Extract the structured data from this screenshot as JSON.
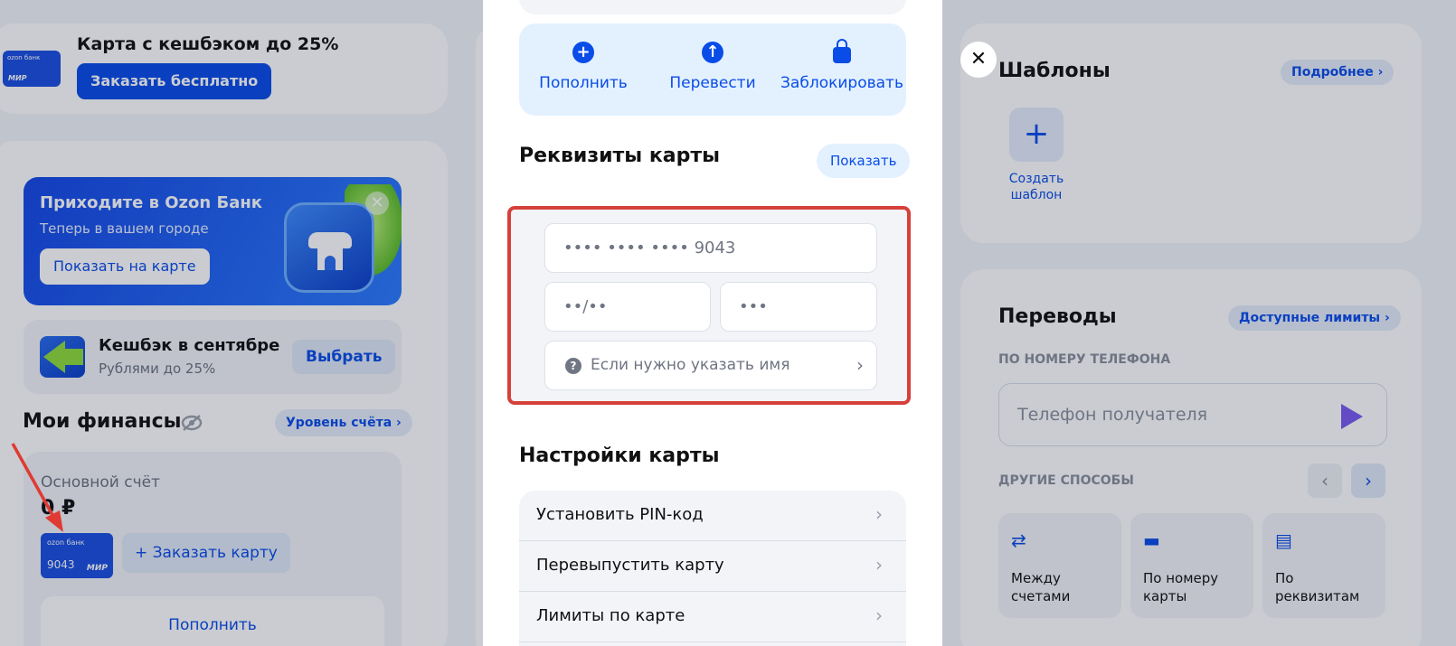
{
  "promo": {
    "card_brand": "ozon банк",
    "card_mir": "МИР",
    "title": "Карта с кешбэком до 25%",
    "button": "Заказать бесплатно"
  },
  "banner": {
    "title": "Приходите в Ozon Банк",
    "subtitle": "Теперь в вашем городе",
    "button": "Показать на карте",
    "close": "✕"
  },
  "cashback": {
    "title": "Кешбэк в сентябре",
    "subtitle": "Рублями до 25%",
    "button": "Выбрать"
  },
  "finances": {
    "title": "Мои финансы",
    "level_button": "Уровень счёта ›",
    "account_label": "Основной счёт",
    "account_value": "0 ₽",
    "card_brand": "ozon банк",
    "card_number": "9043",
    "card_mir": "МИР",
    "order_card_button": "+ Заказать карту",
    "topup_button": "Пополнить"
  },
  "templates": {
    "title": "Шаблоны",
    "more_button": "Подробнее ›",
    "plus": "+",
    "create_label": "Создать шаблон"
  },
  "transfers": {
    "title": "Переводы",
    "limits_button": "Доступные лимиты ›",
    "by_phone_label": "ПО НОМЕРУ ТЕЛЕФОНА",
    "phone_placeholder": "Телефон получателя",
    "other_label": "ДРУГИЕ СПОСОБЫ",
    "prev": "‹",
    "next": "›",
    "methods": [
      {
        "label": "Между счетами",
        "icon": "⇄"
      },
      {
        "label": "По номеру карты",
        "icon": "▬"
      },
      {
        "label": "По реквизитам",
        "icon": "▤"
      }
    ]
  },
  "modal": {
    "close": "✕",
    "actions": [
      {
        "label": "Пополнить",
        "icon": "+"
      },
      {
        "label": "Перевести",
        "icon": "↑"
      },
      {
        "label": "Заблокировать",
        "icon": ""
      }
    ],
    "requisites_title": "Реквизиты карты",
    "show_button": "Показать",
    "card_number": "•••• •••• •••• 9043",
    "expiry": "••/••",
    "cvv": "•••",
    "name_prompt": "Если нужно указать имя",
    "name_q": "?",
    "chevron": "›",
    "settings_title": "Настройки карты",
    "settings": [
      {
        "label": "Установить PIN-код"
      },
      {
        "label": "Перевыпустить карту"
      },
      {
        "label": "Лимиты по карте"
      }
    ]
  },
  "colors": {
    "accent": "#0a4ce8",
    "highlight_border": "#d6403a",
    "arrow": "#e03a32"
  }
}
